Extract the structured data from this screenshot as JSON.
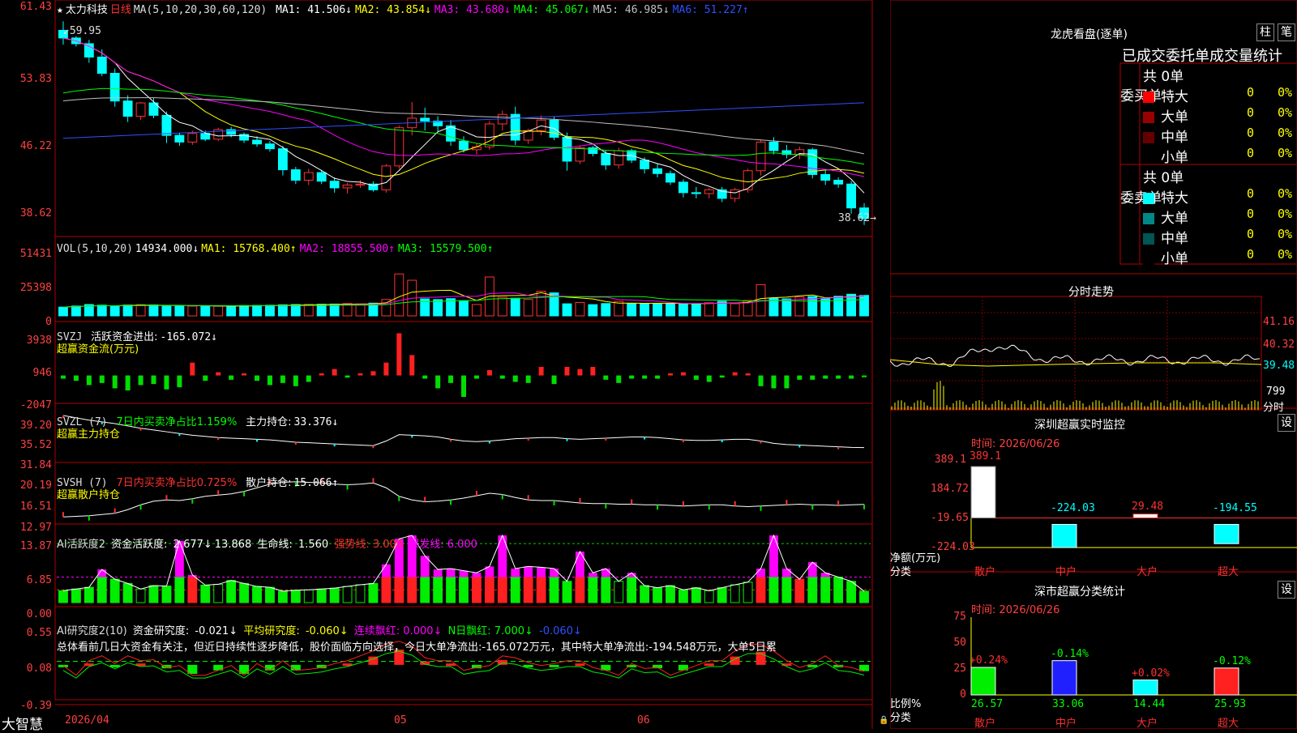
{
  "header": {
    "star_icon": "star-icon",
    "stock_name": "太力科技",
    "period": "日线",
    "ma_label": "MA(5,10,20,30,60,120)",
    "ma": [
      {
        "label": "MA1:",
        "value": "41.506↓",
        "color": "#ffffff"
      },
      {
        "label": "MA2:",
        "value": "43.854↓",
        "color": "#ffff00"
      },
      {
        "label": "MA3:",
        "value": "43.680↓",
        "color": "#ff00ff"
      },
      {
        "label": "MA4:",
        "value": "45.067↓",
        "color": "#00ff00"
      },
      {
        "label": "MA5:",
        "value": "46.985↓",
        "color": "#c0c0c0"
      },
      {
        "label": "MA6:",
        "value": "51.227↑",
        "color": "#3050ff"
      }
    ]
  },
  "price_axis": [
    "61.43",
    "53.83",
    "46.22",
    "38.62"
  ],
  "annotations": {
    "high": "59.95",
    "low": "38.62"
  },
  "vol_header": {
    "title": "VOL(5,10,20)",
    "value": "14934.000↓",
    "ma": [
      {
        "label": "MA1:",
        "value": "15768.400↑",
        "color": "#ffff00"
      },
      {
        "label": "MA2:",
        "value": "18855.500↑",
        "color": "#ff00ff"
      },
      {
        "label": "MA3:",
        "value": "15579.500↑",
        "color": "#00ff00"
      }
    ]
  },
  "vol_axis": [
    "51431",
    "25398",
    "0"
  ],
  "svzj": {
    "title": "SVZJ",
    "label": "活跃资金进出:",
    "value": "-165.072↓",
    "sub": "超赢资金流(万元)",
    "axis": [
      "3938",
      "946",
      "-2047"
    ]
  },
  "svzl": {
    "title": "SVZL (7)",
    "ratio": "7日内买卖净占比1.159%",
    "pos_label": "主力持仓:",
    "pos_value": "33.376↓",
    "sub": "超赢主力持仓",
    "axis": [
      "39.20",
      "35.52",
      "31.84"
    ]
  },
  "svsh": {
    "title": "SVSH (7)",
    "ratio": "7日内买卖净占比0.725%",
    "pos_label": "散户持仓:",
    "pos_value": "15.066↑",
    "sub": "超赢散户持仓",
    "axis": [
      "20.19",
      "16.51",
      "12.97"
    ]
  },
  "ai_active": {
    "title": "AI活跃度2",
    "label": "资金活跃度:",
    "v1": "2.677↓",
    "v2": "13.868",
    "life": "生命线:",
    "life_v": "1.560",
    "strong": "强势线: 3.000",
    "burst": "爆发线: 6.000",
    "axis": [
      "13.87",
      "6.85",
      "0.00"
    ]
  },
  "ai_research": {
    "title": "AI研究度2(10)",
    "label": "资金研究度:",
    "v1": "-0.021↓",
    "avg": "平均研究度:",
    "avg_v": "-0.060↓",
    "red": "连续飘红: 0.000↓",
    "nred": "N日飘红: 7.000↓",
    "last": "-0.060↓",
    "axis": [
      "0.55",
      "0.08",
      "-0.39"
    ],
    "summary": "总体看前几日大资金有关注，但近日持续性逐步降低，股价面临方向选择，今日大单净流出:-165.072万元，其中特大单净流出:-194.548万元，大单5日累"
  },
  "date_axis": {
    "brand": "大智慧",
    "d1": "2026/04",
    "d2": "05",
    "d3": "06"
  },
  "dragon": {
    "title": "龙虎看盘(逐单)",
    "btn1": "柱",
    "btn2": "笔",
    "subtitle": "已成交委托单成交量统计",
    "buy": {
      "label": "委买单",
      "count": "共 0单",
      "rows": [
        {
          "name": "特大",
          "v": "0",
          "p": "0%",
          "c": "#ff0000"
        },
        {
          "name": "大单",
          "v": "0",
          "p": "0%",
          "c": "#990000"
        },
        {
          "name": "中单",
          "v": "0",
          "p": "0%",
          "c": "#660000"
        },
        {
          "name": "小单",
          "v": "0",
          "p": "0%",
          "c": "#000000"
        }
      ]
    },
    "sell": {
      "label": "委卖单",
      "count": "共 0单",
      "rows": [
        {
          "name": "特大",
          "v": "0",
          "p": "0%",
          "c": "#00ffff"
        },
        {
          "name": "大单",
          "v": "0",
          "p": "0%",
          "c": "#008888"
        },
        {
          "name": "中单",
          "v": "0",
          "p": "0%",
          "c": "#005555"
        },
        {
          "name": "小单",
          "v": "0",
          "p": "0%",
          "c": "#000000"
        }
      ]
    }
  },
  "intraday": {
    "title": "分时走势",
    "axis": [
      "41.16",
      "40.32",
      "39.48"
    ],
    "vol": "799",
    "vol_unit": "分时"
  },
  "monitor": {
    "title": "深圳超赢实时监控",
    "btn": "设",
    "time": "时间: 2026/06/26",
    "axis": [
      "389.1",
      "184.72",
      "-19.65",
      "-224.03"
    ],
    "ylabel": "净额(万元)",
    "xlabel": "分类",
    "cats": [
      "散户",
      "中户",
      "大户",
      "超大"
    ],
    "vals": [
      "389.1",
      "-224.03",
      "29.48",
      "-194.55"
    ]
  },
  "classify": {
    "title": "深市超赢分类统计",
    "btn": "设",
    "time": "时间: 2026/06/26",
    "axis": [
      "75",
      "50",
      "25",
      "0"
    ],
    "ylabel": "比例%",
    "xlabel": "分类",
    "cats": [
      "散户",
      "中户",
      "大户",
      "超大"
    ],
    "vals": [
      "26.57",
      "33.06",
      "14.44",
      "25.93"
    ],
    "chg": [
      "+0.24%",
      "-0.14%",
      "+0.02%",
      "-0.12%"
    ]
  },
  "chart_data": {
    "type": "candlestick",
    "ohlc": [
      [
        59,
        59.95,
        57.5,
        58.2
      ],
      [
        58.2,
        58.4,
        57.3,
        57.6
      ],
      [
        57.6,
        58.0,
        55.6,
        56.2
      ],
      [
        56.2,
        57.0,
        54.2,
        54.5
      ],
      [
        54.5,
        55.0,
        51.0,
        51.6
      ],
      [
        51.6,
        52.2,
        49.4,
        50.0
      ],
      [
        50.0,
        51.5,
        49.6,
        51.4
      ],
      [
        51.4,
        51.9,
        49.8,
        50.1
      ],
      [
        50.1,
        50.5,
        47.2,
        48.0
      ],
      [
        48.0,
        48.3,
        46.9,
        47.3
      ],
      [
        47.3,
        48.5,
        47.0,
        48.2
      ],
      [
        48.2,
        48.5,
        47.4,
        47.6
      ],
      [
        47.6,
        48.8,
        47.4,
        48.6
      ],
      [
        48.6,
        48.9,
        47.8,
        48.1
      ],
      [
        48.1,
        48.3,
        47.2,
        47.5
      ],
      [
        47.5,
        47.9,
        46.8,
        47.1
      ],
      [
        47.1,
        47.4,
        46.3,
        46.6
      ],
      [
        46.6,
        46.9,
        43.8,
        44.4
      ],
      [
        44.4,
        44.7,
        42.9,
        43.3
      ],
      [
        43.3,
        44.5,
        42.8,
        44.1
      ],
      [
        44.1,
        44.4,
        42.9,
        43.2
      ],
      [
        43.2,
        43.6,
        42.0,
        42.5
      ],
      [
        42.5,
        43.0,
        41.9,
        42.8
      ],
      [
        42.8,
        43.3,
        42.5,
        42.9
      ],
      [
        42.9,
        43.2,
        42.1,
        42.3
      ],
      [
        42.3,
        45.0,
        42.0,
        44.8
      ],
      [
        44.8,
        49.0,
        44.5,
        48.8
      ],
      [
        48.8,
        51.5,
        48.0,
        49.8
      ],
      [
        49.8,
        50.9,
        48.5,
        49.5
      ],
      [
        49.5,
        50.0,
        48.3,
        49.0
      ],
      [
        49.0,
        49.6,
        46.9,
        47.4
      ],
      [
        47.4,
        47.9,
        46.2,
        46.5
      ],
      [
        46.5,
        47.2,
        46.0,
        46.8
      ],
      [
        46.8,
        49.5,
        46.5,
        49.2
      ],
      [
        49.2,
        50.6,
        48.5,
        50.2
      ],
      [
        50.2,
        51.0,
        47.0,
        47.5
      ],
      [
        47.5,
        48.7,
        47.1,
        48.5
      ],
      [
        48.5,
        50.1,
        48.0,
        49.6
      ],
      [
        49.6,
        50.0,
        47.5,
        47.8
      ],
      [
        47.8,
        48.3,
        44.3,
        45.3
      ],
      [
        45.3,
        46.9,
        45.0,
        46.7
      ],
      [
        46.7,
        46.9,
        45.8,
        46.1
      ],
      [
        46.1,
        46.4,
        44.4,
        44.9
      ],
      [
        44.9,
        46.7,
        44.5,
        46.4
      ],
      [
        46.4,
        46.6,
        45.1,
        45.4
      ],
      [
        45.4,
        45.7,
        44.0,
        44.5
      ],
      [
        44.5,
        45.0,
        43.6,
        44.0
      ],
      [
        44.0,
        44.3,
        42.8,
        43.1
      ],
      [
        43.1,
        43.4,
        41.5,
        42.0
      ],
      [
        42.0,
        42.6,
        41.4,
        41.9
      ],
      [
        41.9,
        42.5,
        41.4,
        42.3
      ],
      [
        42.3,
        42.6,
        41.0,
        41.4
      ],
      [
        41.4,
        42.5,
        41.0,
        42.3
      ],
      [
        42.3,
        44.5,
        42.0,
        44.3
      ],
      [
        44.3,
        47.5,
        43.8,
        47.3
      ],
      [
        47.3,
        47.8,
        46.0,
        46.4
      ],
      [
        46.4,
        47.0,
        45.6,
        46.0
      ],
      [
        46.0,
        46.8,
        45.5,
        46.5
      ],
      [
        46.5,
        46.7,
        43.5,
        43.9
      ],
      [
        43.9,
        44.4,
        42.8,
        43.3
      ],
      [
        43.3,
        43.6,
        42.5,
        42.9
      ],
      [
        42.9,
        43.2,
        39.8,
        40.4
      ],
      [
        40.4,
        40.9,
        38.62,
        39.3
      ]
    ],
    "ylim": [
      38,
      61.5
    ],
    "volume": [
      6400,
      7200,
      8300,
      7800,
      7200,
      7900,
      8200,
      8000,
      7500,
      7300,
      7100,
      7000,
      7100,
      7200,
      7600,
      7700,
      7800,
      8100,
      8300,
      8400,
      8500,
      8600,
      9000,
      8700,
      9300,
      12000,
      30600,
      26000,
      12400,
      11900,
      12600,
      11000,
      8300,
      28400,
      13600,
      12900,
      12000,
      18000,
      16800,
      8800,
      9800,
      8200,
      9000,
      10600,
      8900,
      9000,
      8800,
      8900,
      9000,
      8700,
      9600,
      10700,
      8900,
      11300,
      22800,
      12900,
      12400,
      13800,
      14100,
      12800,
      14300,
      15800,
      14934
    ],
    "vol_ylim": [
      0,
      55000
    ],
    "svzj": [
      -300,
      -500,
      -900,
      -700,
      -1200,
      -1400,
      -900,
      -800,
      -1300,
      -1100,
      1200,
      -500,
      300,
      -400,
      200,
      -500,
      -900,
      -700,
      -1000,
      -600,
      200,
      600,
      -200,
      200,
      400,
      1200,
      3938,
      1900,
      -300,
      -1200,
      -700,
      -2000,
      -300,
      500,
      -300,
      -600,
      -700,
      800,
      -800,
      800,
      600,
      800,
      -400,
      -700,
      -300,
      -300,
      -300,
      200,
      300,
      -400,
      -600,
      -200,
      300,
      200,
      -1000,
      -1200,
      -1200,
      -400,
      -400,
      -300,
      -300,
      -300,
      -165.072
    ],
    "svzj_ylim": [
      -2300,
      4200
    ],
    "svzl": [
      38.9,
      38.5,
      38.1,
      37.8,
      37.5,
      37.1,
      36.7,
      36.4,
      36.1,
      35.8,
      35.5,
      35.3,
      35.1,
      35.0,
      34.9,
      34.8,
      34.7,
      34.5,
      34.3,
      34.2,
      34.1,
      34.0,
      33.9,
      33.8,
      33.7,
      34.5,
      35.6,
      35.5,
      35.4,
      35.2,
      34.8,
      34.5,
      34.4,
      34.5,
      34.7,
      34.9,
      35.0,
      35.1,
      35.1,
      34.9,
      34.8,
      34.9,
      35.0,
      35.1,
      35.2,
      35.2,
      35.1,
      34.9,
      34.7,
      34.6,
      34.6,
      34.7,
      34.8,
      34.8,
      34.5,
      34.1,
      33.9,
      33.8,
      33.7,
      33.6,
      33.5,
      33.4,
      33.376
    ],
    "svzl_ylim": [
      31.5,
      39.6
    ],
    "svsh": [
      13.0,
      13.1,
      13.2,
      13.4,
      13.6,
      14.2,
      15.0,
      15.6,
      15.8,
      15.7,
      16.0,
      16.4,
      16.6,
      16.8,
      17.2,
      17.8,
      18.4,
      18.7,
      18.8,
      18.7,
      18.6,
      18.4,
      18.3,
      18.4,
      18.6,
      17.8,
      16.4,
      15.8,
      15.5,
      15.6,
      15.8,
      16.1,
      16.5,
      16.9,
      16.7,
      16.2,
      15.8,
      15.7,
      15.7,
      15.5,
      15.3,
      15.2,
      15.2,
      15.1,
      15.1,
      15.0,
      15.0,
      14.9,
      14.8,
      14.9,
      15.0,
      15.0,
      14.8,
      14.7,
      14.8,
      14.9,
      15.0,
      15.1,
      15.0,
      15.0,
      14.9,
      15.0,
      15.066
    ],
    "svsh_ylim": [
      12.5,
      20.5
    ],
    "active": [
      2.8,
      3.2,
      3.6,
      7.8,
      5.5,
      4.5,
      3.2,
      4.0,
      3.9,
      14.5,
      6.5,
      4.1,
      4.3,
      5.2,
      4.5,
      3.8,
      3.6,
      2.7,
      2.9,
      3.0,
      3.2,
      3.4,
      3.8,
      4.2,
      4.5,
      9.0,
      15.0,
      18.0,
      11.0,
      7.8,
      8.0,
      7.5,
      7.0,
      8.5,
      18.0,
      8.0,
      8.5,
      8.3,
      8.0,
      5.0,
      12.0,
      7.0,
      8.0,
      5.0,
      7.0,
      4.0,
      3.5,
      4.0,
      3.0,
      3.5,
      2.8,
      3.5,
      4.2,
      4.8,
      8.0,
      18.0,
      8.0,
      5.5,
      9.5,
      7.0,
      6.0,
      5.0,
      2.677
    ],
    "active_ylim": [
      0,
      16
    ],
    "research": [
      0.0,
      -0.1,
      0.05,
      0.1,
      0.02,
      0.1,
      0.05,
      0.06,
      -0.02,
      0.0,
      -0.1,
      -0.1,
      -0.05,
      0.0,
      -0.1,
      0.02,
      -0.05,
      0.05,
      -0.05,
      -0.04,
      -0.02,
      0.02,
      0.05,
      0.1,
      0.15,
      0.22,
      0.25,
      0.2,
      0.08,
      0.05,
      0.05,
      -0.05,
      -0.02,
      0.0,
      0.1,
      0.08,
      0.03,
      0.0,
      0.02,
      0.05,
      0.05,
      -0.02,
      -0.05,
      -0.1,
      0.02,
      -0.03,
      -0.02,
      -0.1,
      -0.05,
      0.0,
      0.05,
      0.05,
      0.15,
      0.22,
      0.22,
      0.15,
      0.05,
      -0.02,
      0.02,
      0.1,
      0.0,
      -0.02,
      -0.06
    ],
    "research_ylim": [
      -0.45,
      0.6
    ],
    "monitor_values": [
      389.1,
      -224.03,
      29.48,
      -194.55
    ],
    "classify_values": [
      26.57,
      33.06,
      14.44,
      25.93
    ]
  }
}
